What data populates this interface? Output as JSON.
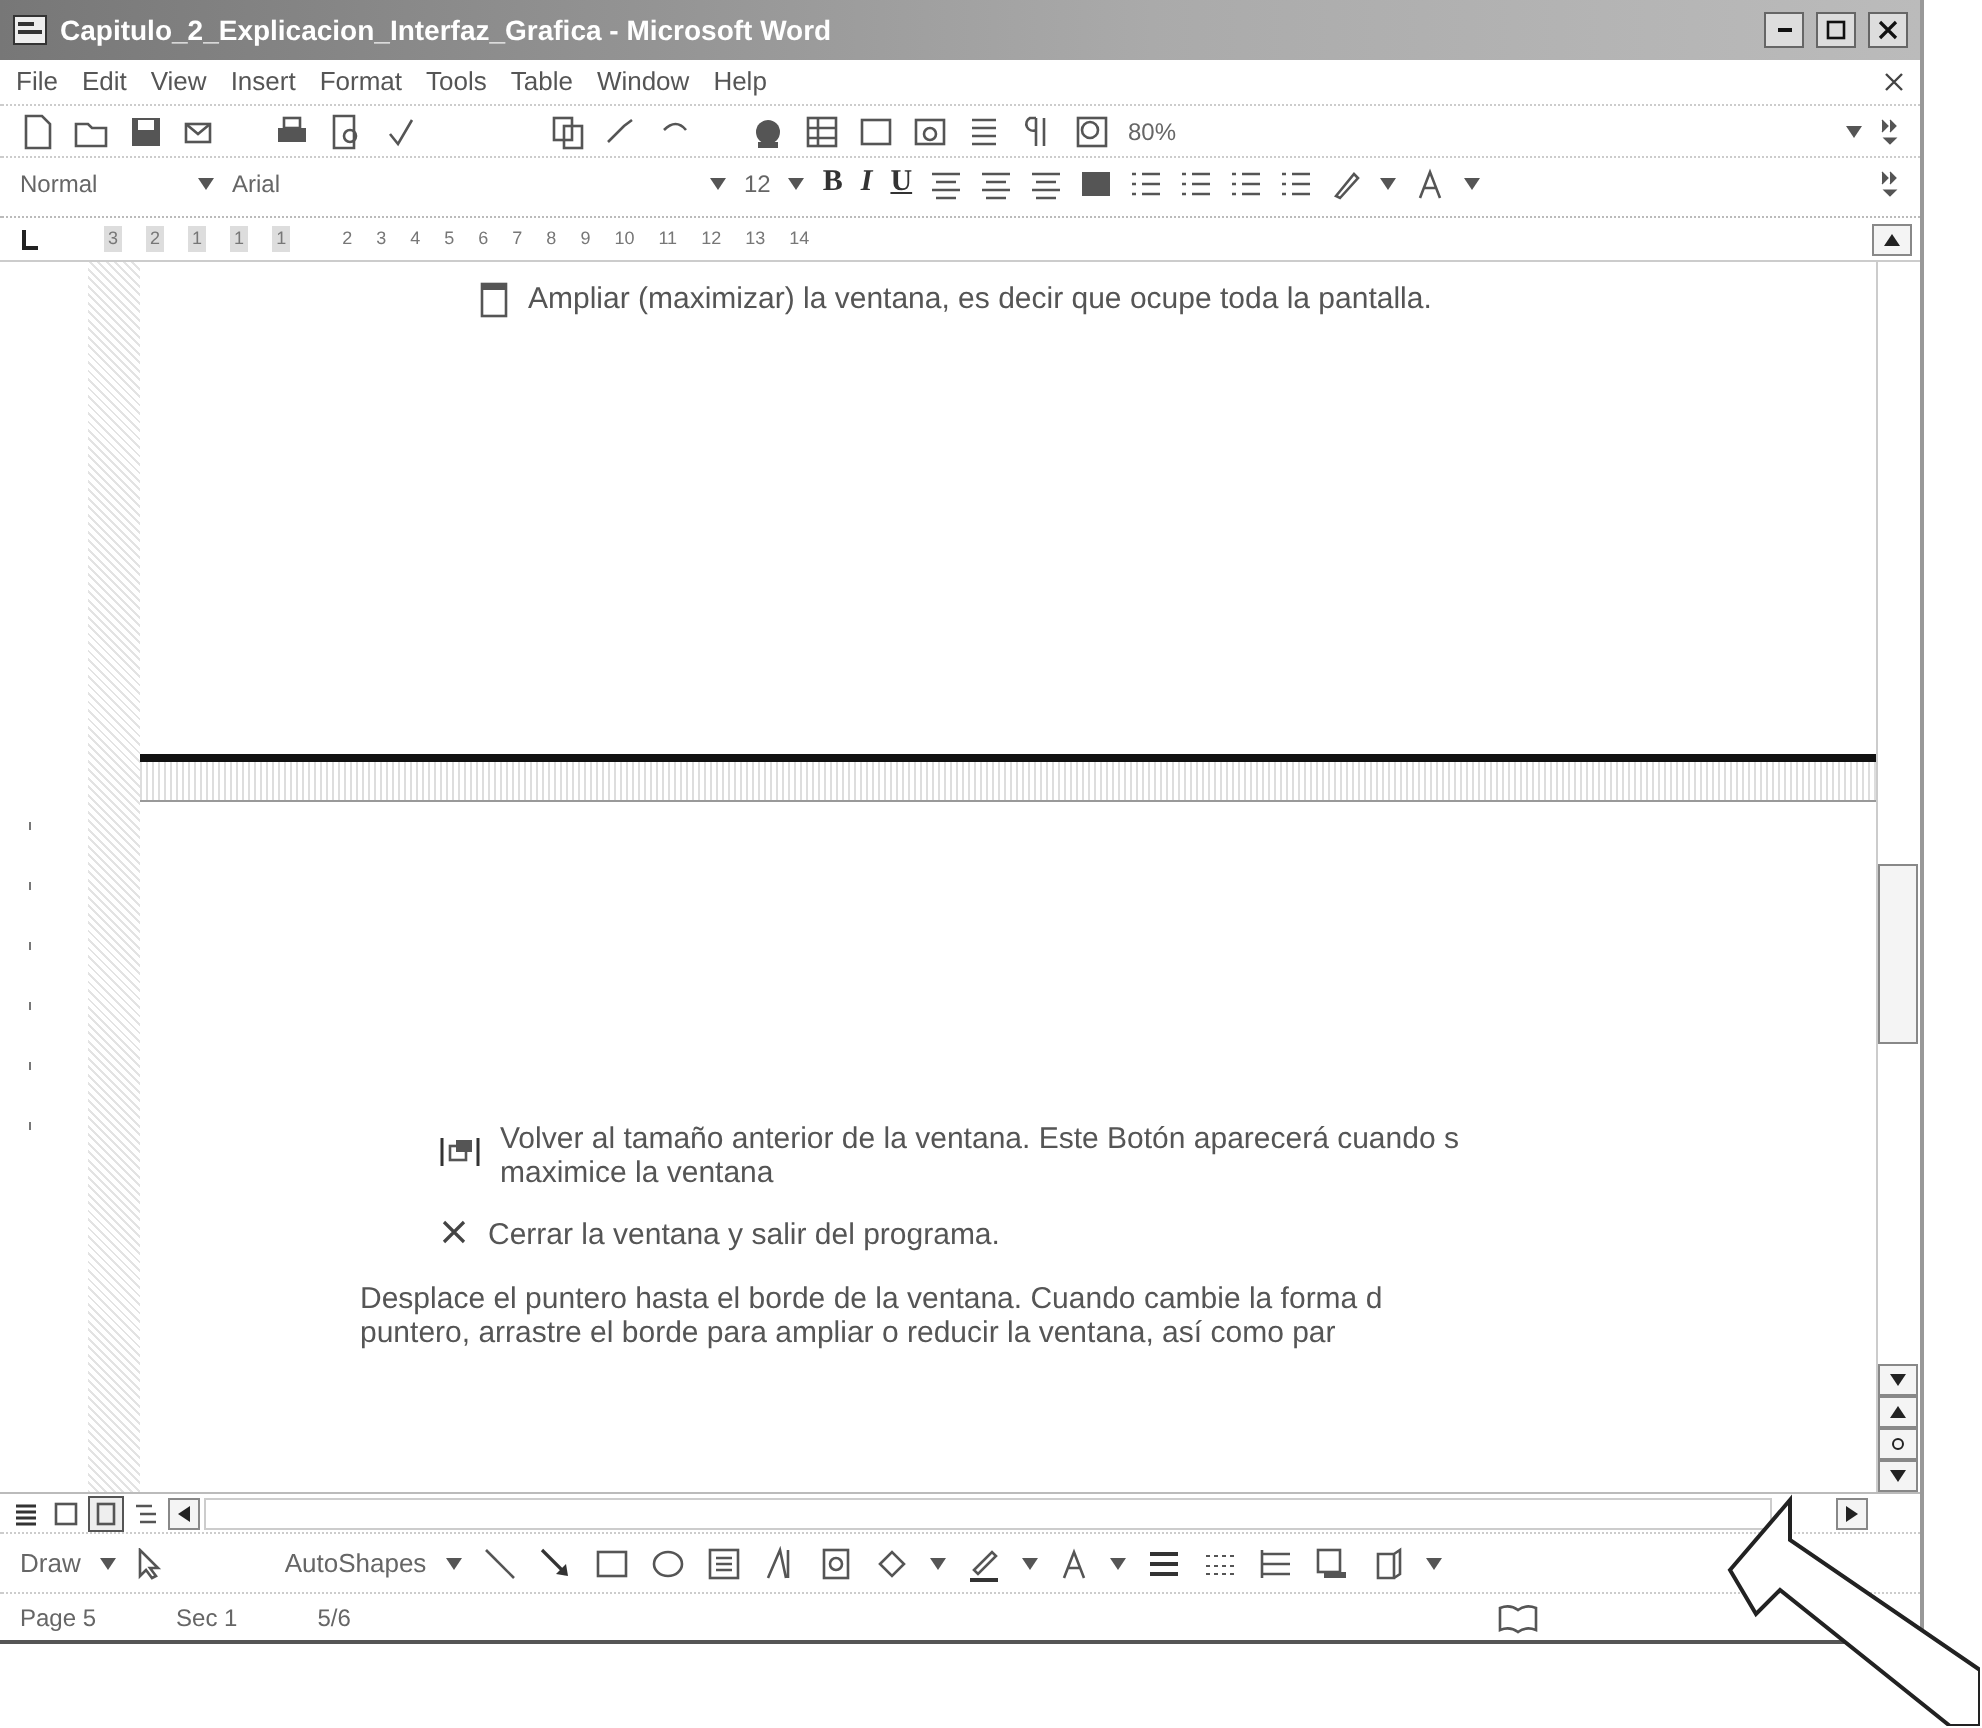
{
  "window": {
    "title": "Capitulo_2_Explicacion_Interfaz_Grafica - Microsoft Word"
  },
  "menu": [
    {
      "label": "File"
    },
    {
      "label": "Edit"
    },
    {
      "label": "View"
    },
    {
      "label": "Insert"
    },
    {
      "label": "Format"
    },
    {
      "label": "Tools"
    },
    {
      "label": "Table"
    },
    {
      "label": "Window"
    },
    {
      "label": "Help"
    }
  ],
  "standard_toolbar": {
    "zoom": "80%"
  },
  "formatting_toolbar": {
    "style": "Normal",
    "font": "Arial",
    "size": "12",
    "bold": "B",
    "italic": "I",
    "underline": "U"
  },
  "ruler": {
    "labels": [
      "3",
      "2",
      "1",
      "1",
      "1",
      "2",
      "3",
      "4",
      "5",
      "6",
      "7",
      "8",
      "9",
      "10",
      "11",
      "12",
      "13",
      "14"
    ]
  },
  "document": {
    "top_items": [
      {
        "kind": "maximize",
        "lines": [
          "Ampliar (maximizar) la ventana, es decir que ocupe toda la pantalla."
        ]
      }
    ],
    "bottom_items": [
      {
        "kind": "restore",
        "lines": [
          "Volver al tamaño anterior de la ventana. Este Botón aparecerá cuando s",
          "maximice la ventana"
        ]
      },
      {
        "kind": "close",
        "lines": [
          "Cerrar la ventana y salir del programa."
        ]
      },
      {
        "kind": "plain",
        "lines": [
          "Desplace el puntero hasta el borde de la ventana. Cuando cambie la forma d",
          "puntero, arrastre el borde para ampliar o reducir la ventana, así como par"
        ]
      }
    ]
  },
  "view_buttons": [
    {
      "selected": false
    },
    {
      "selected": false
    },
    {
      "selected": true
    },
    {
      "selected": false
    }
  ],
  "drawing_toolbar": {
    "draw": "Draw",
    "autoshapes": "AutoShapes"
  },
  "status_bar": [
    "Page 5",
    "Sec 1",
    "5/6"
  ]
}
